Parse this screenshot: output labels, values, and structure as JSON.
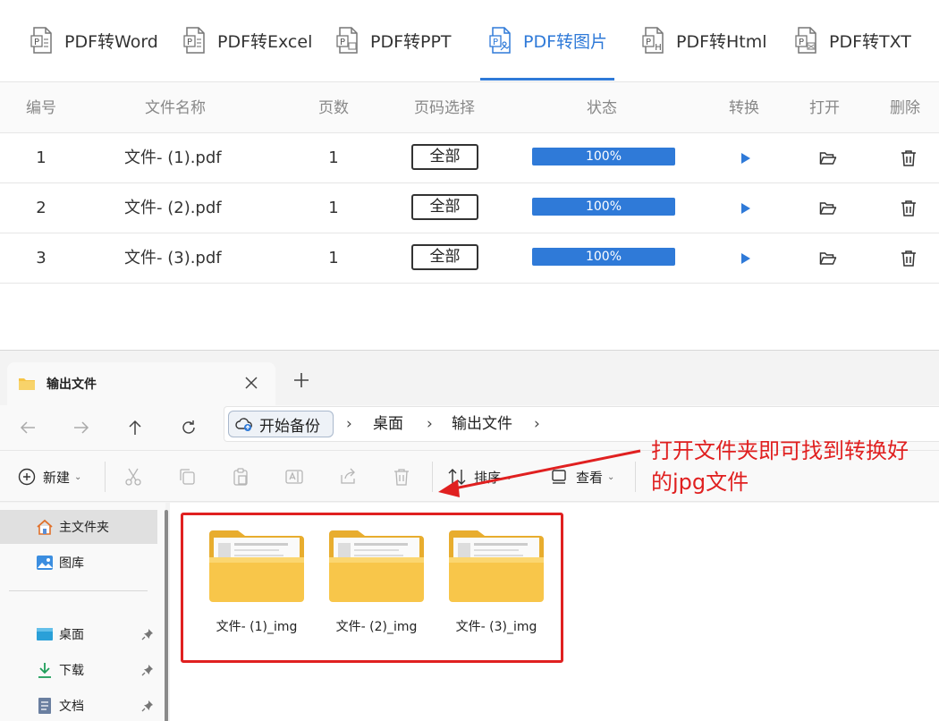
{
  "tabs": [
    {
      "label": "PDF转Word",
      "icon": "pdf-word-icon",
      "active": false
    },
    {
      "label": "PDF转Excel",
      "icon": "pdf-excel-icon",
      "active": false
    },
    {
      "label": "PDF转PPT",
      "icon": "pdf-ppt-icon",
      "active": false
    },
    {
      "label": "PDF转图片",
      "icon": "pdf-image-icon",
      "active": true
    },
    {
      "label": "PDF转Html",
      "icon": "pdf-html-icon",
      "active": false
    },
    {
      "label": "PDF转TXT",
      "icon": "pdf-txt-icon",
      "active": false
    }
  ],
  "table": {
    "headers": {
      "index": "编号",
      "name": "文件名称",
      "pages": "页数",
      "page_select": "页码选择",
      "status": "状态",
      "convert": "转换",
      "open": "打开",
      "delete": "删除"
    },
    "rows": [
      {
        "index": "1",
        "name": "文件- (1).pdf",
        "pages": "1",
        "page_select": "全部",
        "progress": 100,
        "progress_text": "100%"
      },
      {
        "index": "2",
        "name": "文件- (2).pdf",
        "pages": "1",
        "page_select": "全部",
        "progress": 100,
        "progress_text": "100%"
      },
      {
        "index": "3",
        "name": "文件- (3).pdf",
        "pages": "1",
        "page_select": "全部",
        "progress": 100,
        "progress_text": "100%"
      }
    ]
  },
  "explorer": {
    "tab_title": "输出文件",
    "address": {
      "backup": "开始备份",
      "crumbs": [
        "桌面",
        "输出文件"
      ]
    },
    "commands": {
      "new": "新建",
      "sort": "排序",
      "view": "查看"
    },
    "sidebar": {
      "items": [
        {
          "label": "主文件夹",
          "icon": "home-icon"
        },
        {
          "label": "图库",
          "icon": "gallery-icon"
        },
        {
          "label": "桌面",
          "icon": "desktop-icon"
        },
        {
          "label": "下载",
          "icon": "download-icon"
        },
        {
          "label": "文档",
          "icon": "document-icon"
        }
      ]
    },
    "folders": [
      {
        "label": "文件- (1)_img"
      },
      {
        "label": "文件- (2)_img"
      },
      {
        "label": "文件- (3)_img"
      }
    ]
  },
  "annotation": {
    "line1": "打开文件夹即可找到转换好",
    "line2": "的jpg文件"
  },
  "colors": {
    "accent": "#2f7ad8",
    "annotation": "#e02020",
    "folder": "#f6c445"
  }
}
